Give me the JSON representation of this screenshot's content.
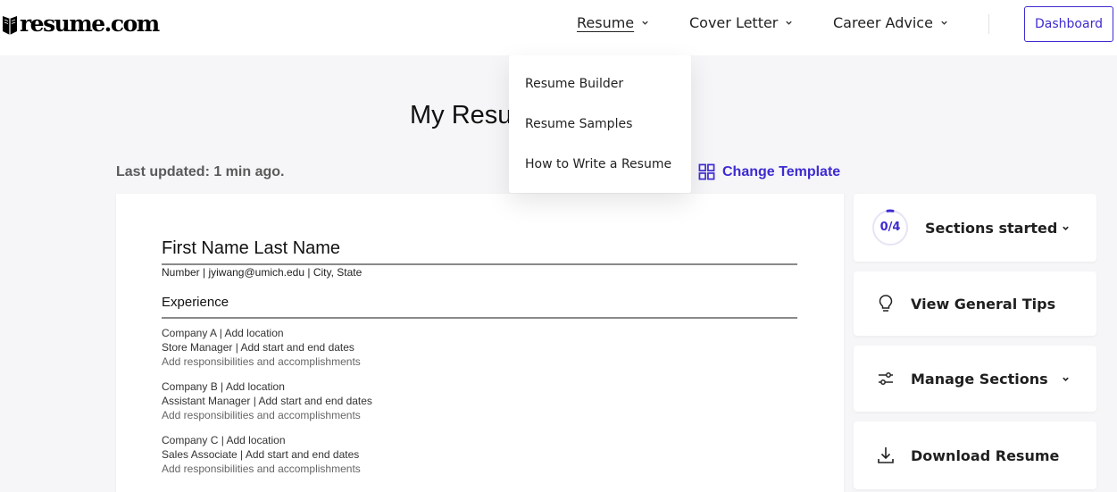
{
  "header": {
    "logo_text": "resume.com",
    "nav": [
      {
        "label": "Resume",
        "active": true
      },
      {
        "label": "Cover Letter",
        "active": false
      },
      {
        "label": "Career Advice",
        "active": false
      }
    ],
    "dashboard_label": "Dashboard"
  },
  "dropdown": {
    "items": [
      "Resume Builder",
      "Resume Samples",
      "How to Write a Resume"
    ]
  },
  "page": {
    "title": "My Resume",
    "last_updated": "Last updated: 1 min ago.",
    "change_template_label": "Change Template"
  },
  "resume": {
    "name": "First Name Last Name",
    "contact": "Number | jyiwang@umich.edu | City, State",
    "section_title": "Experience",
    "jobs": [
      {
        "company": "Company A | Add location",
        "title": "Store Manager | Add start and end dates",
        "desc": "Add responsibilities and accomplishments"
      },
      {
        "company": "Company B | Add location",
        "title": "Assistant Manager | Add start and end dates",
        "desc": "Add responsibilities and accomplishments"
      },
      {
        "company": "Company C | Add location",
        "title": "Sales Associate | Add start and end dates",
        "desc": "Add responsibilities and accomplishments"
      }
    ]
  },
  "sidebar": {
    "sections_started": {
      "progress_text": "0/4",
      "completed": 0,
      "total": 4,
      "label": "Sections started"
    },
    "tips_label": "View General Tips",
    "manage_label": "Manage Sections",
    "download_label": "Download Resume"
  },
  "colors": {
    "accent": "#3d2bd1",
    "background": "#f6f6f8"
  }
}
